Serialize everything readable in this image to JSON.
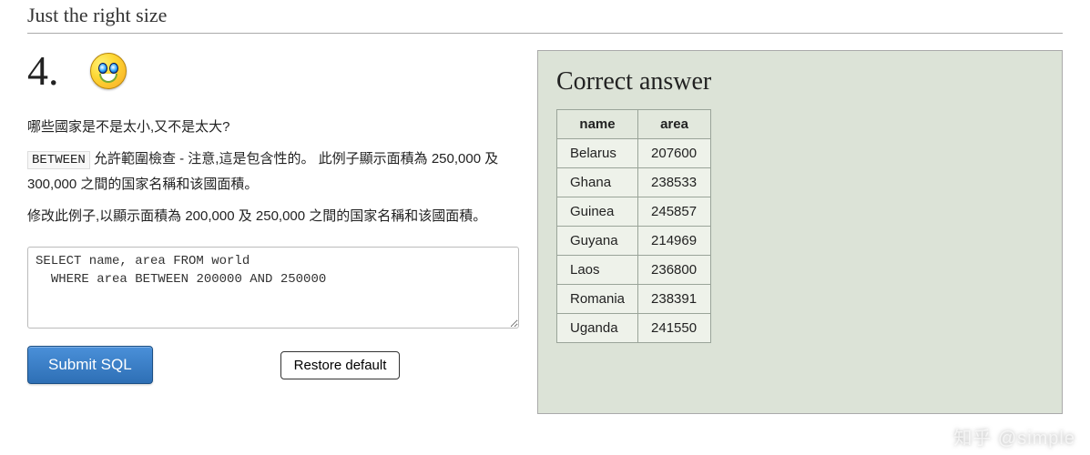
{
  "title": "Just the right size",
  "question_number": "4.",
  "smiley_name": "grin-face",
  "question": {
    "p1": "哪些國家是不是太小,又不是太大?",
    "keyword": "BETWEEN",
    "p2_after_kwd": " 允許範圍檢查 - 注意,這是包含性的。 此例子顯示面積為 250,000 及 300,000 之間的国家名稱和该國面積。",
    "p3": "修改此例子,以顯示面積為 200,000 及 250,000 之間的国家名稱和该國面積。"
  },
  "sql": "SELECT name, area FROM world\n  WHERE area BETWEEN 200000 AND 250000",
  "buttons": {
    "submit": "Submit SQL",
    "restore": "Restore default"
  },
  "answer": {
    "heading": "Correct answer",
    "columns": [
      "name",
      "area"
    ],
    "rows": [
      [
        "Belarus",
        "207600"
      ],
      [
        "Ghana",
        "238533"
      ],
      [
        "Guinea",
        "245857"
      ],
      [
        "Guyana",
        "214969"
      ],
      [
        "Laos",
        "236800"
      ],
      [
        "Romania",
        "238391"
      ],
      [
        "Uganda",
        "241550"
      ]
    ]
  },
  "watermark": "知乎 @simple"
}
